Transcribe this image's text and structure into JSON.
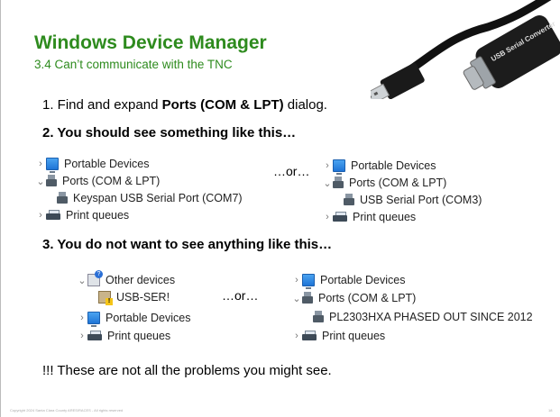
{
  "slide": {
    "title": "Windows Device Manager",
    "subtitle": "3.4 Can’t communicate with the TNC",
    "step1_prefix": "1.  Find and expand ",
    "step1_bold": "Ports (COM & LPT)",
    "step1_suffix": " dialog.",
    "step2": "2.  You should see something like this…",
    "step3": "3.  You do not want to see anything like this…",
    "note": "!!! These are not all the problems you might see.",
    "or_label": "…or…",
    "footer": "Copyright 2024 Santa Clara County ARES/RACES - All rights reserved",
    "page_number": "18"
  },
  "device_label": "USB Serial Converter",
  "good_example_a": {
    "portable": "Portable Devices",
    "ports": "Ports (COM & LPT)",
    "device": "Keyspan USB Serial Port (COM7)",
    "print": "Print queues"
  },
  "good_example_b": {
    "portable": "Portable Devices",
    "ports": "Ports (COM & LPT)",
    "device": "USB Serial Port (COM3)",
    "print": "Print queues"
  },
  "bad_example_a": {
    "other": "Other devices",
    "device": "USB-SER!",
    "portable": "Portable Devices",
    "print": "Print queues"
  },
  "bad_example_b": {
    "portable": "Portable Devices",
    "ports": "Ports (COM & LPT)",
    "device": "PL2303HXA PHASED OUT SINCE 2012",
    "print": "Print queues"
  }
}
